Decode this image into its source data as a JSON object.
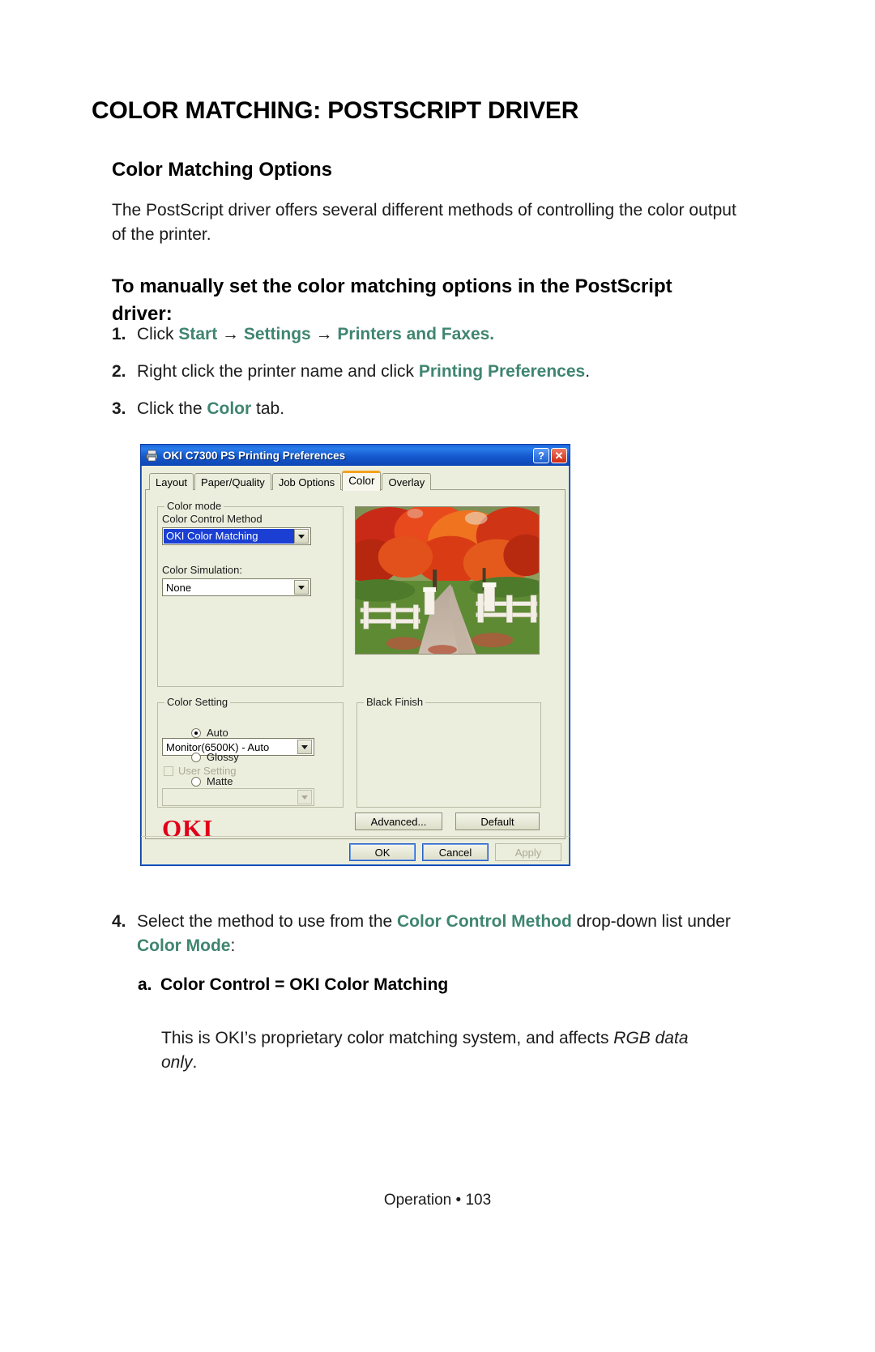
{
  "document": {
    "title": "COLOR MATCHING: POSTSCRIPT DRIVER",
    "section_heading": "Color Matching Options",
    "intro_paragraph": "The PostScript driver offers several different methods of controlling the color output of the printer.",
    "procedure_heading": "To manually set the color matching options in the PostScript driver:",
    "steps": [
      {
        "number": "1.",
        "pre": "Click ",
        "link1": "Start",
        "arrow1": " → ",
        "link2": "Settings",
        "arrow2": " → ",
        "link3": "Printers and Faxes.",
        "post": ""
      },
      {
        "number": "2.",
        "pre": "Right click the printer name and click ",
        "link1": "Printing Preferences",
        "post": "."
      },
      {
        "number": "3.",
        "pre": "Click the ",
        "link1": "Color",
        "post": " tab."
      },
      {
        "number": "4.",
        "pre": "Select the method to use from the ",
        "link1": "Color Control Method",
        "mid": " drop-down list under ",
        "link2": "Color Mode",
        "post": ":"
      }
    ],
    "substep_a": {
      "letter": "a.",
      "label": "Color Control = OKI Color Matching",
      "description_plain": "This is OKI’s proprietary color matching system, and affects ",
      "description_italic": "RGB data only",
      "description_end": "."
    },
    "footer": "Operation • 103",
    "accent_color": "#3f8570"
  },
  "dialog": {
    "title": "OKI C7300 PS Printing Preferences",
    "titlebar_icon": "printer-icon",
    "help_button": "?",
    "close_button": "✕",
    "tabs": [
      {
        "label": "Layout",
        "active": false
      },
      {
        "label": "Paper/Quality",
        "active": false
      },
      {
        "label": "Job Options",
        "active": false
      },
      {
        "label": "Color",
        "active": true
      },
      {
        "label": "Overlay",
        "active": false
      }
    ],
    "color_mode_group": {
      "legend": "Color mode",
      "color_control_method_label": "Color Control Method",
      "color_control_method_value": "OKI Color Matching",
      "color_simulation_label": "Color Simulation:",
      "color_simulation_value": "None"
    },
    "color_setting_group": {
      "legend": "Color Setting",
      "setting_value": "Monitor(6500K) - Auto",
      "user_setting_label": "User Setting",
      "user_setting_checked": false,
      "user_setting_value": ""
    },
    "black_finish_group": {
      "legend": "Black Finish",
      "options": [
        {
          "label": "Auto",
          "selected": true
        },
        {
          "label": "Glossy",
          "selected": false
        },
        {
          "label": "Matte",
          "selected": false
        }
      ]
    },
    "brand_logo": "OKI",
    "buttons": {
      "advanced": "Advanced...",
      "default": "Default",
      "ok": "OK",
      "cancel": "Cancel",
      "apply": "Apply"
    },
    "colors": {
      "titlebar_blue": "#1559cf",
      "dialog_face": "#eceedd",
      "active_tab_accent": "#f4a11c",
      "selection_blue": "#1a3fd2",
      "oki_red": "#e2001a"
    },
    "preview_image": "autumn-trees-road-photo"
  }
}
